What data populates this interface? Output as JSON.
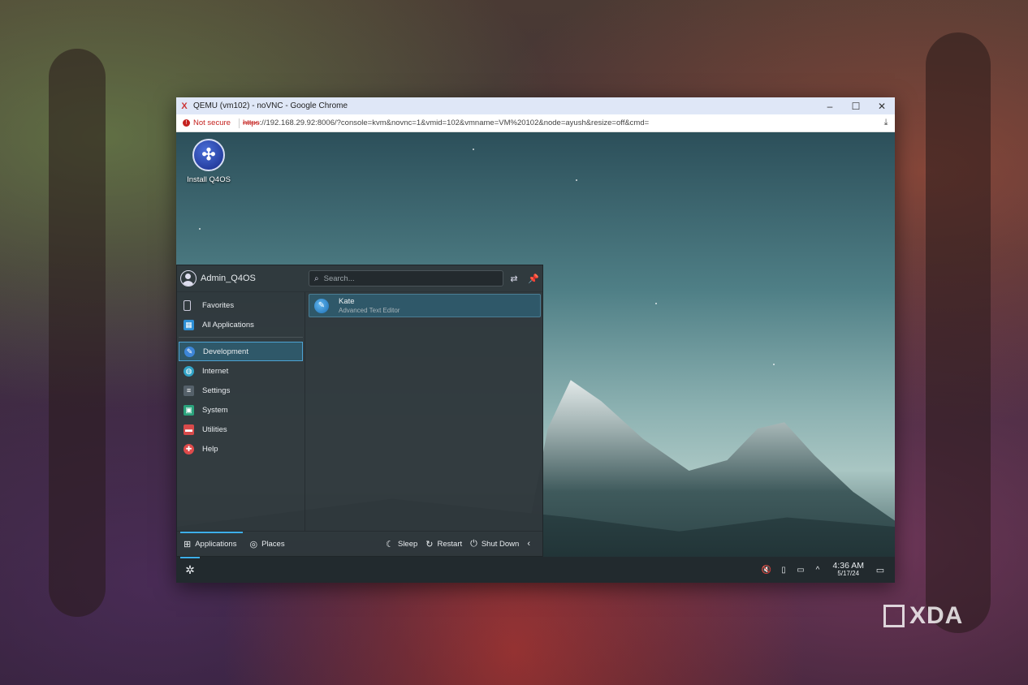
{
  "browser": {
    "window_title": "QEMU (vm102) - noVNC - Google Chrome",
    "app_icon": "X",
    "minimize": "–",
    "maximize": "☐",
    "close": "✕",
    "security_label": "Not secure",
    "url_scheme": "https",
    "url_rest": "://192.168.29.92:8006/?console=kvm&novnc=1&vmid=102&vmname=VM%20102&node=ayush&resize=off&cmd=",
    "download_icon": "⤓"
  },
  "desktop": {
    "icon_label": "Install Q4OS",
    "icon_glyph": "✣"
  },
  "menu": {
    "user_name": "Admin_Q4OS",
    "search_placeholder": "Search...",
    "categories": [
      {
        "label": "Favorites",
        "icon": "bookmark-icon"
      },
      {
        "label": "All Applications",
        "icon": "grid-icon"
      },
      {
        "label": "Development",
        "icon": "development-icon"
      },
      {
        "label": "Internet",
        "icon": "globe-icon"
      },
      {
        "label": "Settings",
        "icon": "settings-icon"
      },
      {
        "label": "System",
        "icon": "system-icon"
      },
      {
        "label": "Utilities",
        "icon": "utilities-icon"
      },
      {
        "label": "Help",
        "icon": "help-icon"
      }
    ],
    "active_category": "Development",
    "apps": [
      {
        "name": "Kate",
        "description": "Advanced Text Editor"
      }
    ],
    "footer": {
      "tab_applications": "Applications",
      "tab_places": "Places",
      "sleep": "Sleep",
      "restart": "Restart",
      "shutdown": "Shut Down"
    }
  },
  "panel": {
    "time": "4:36 AM",
    "date": "5/17/24"
  },
  "watermark": "XDA",
  "colors": {
    "accent": "#3daee9",
    "selection": "#2f5869",
    "panel": "#222a2e",
    "not_secure": "#c5221f"
  }
}
